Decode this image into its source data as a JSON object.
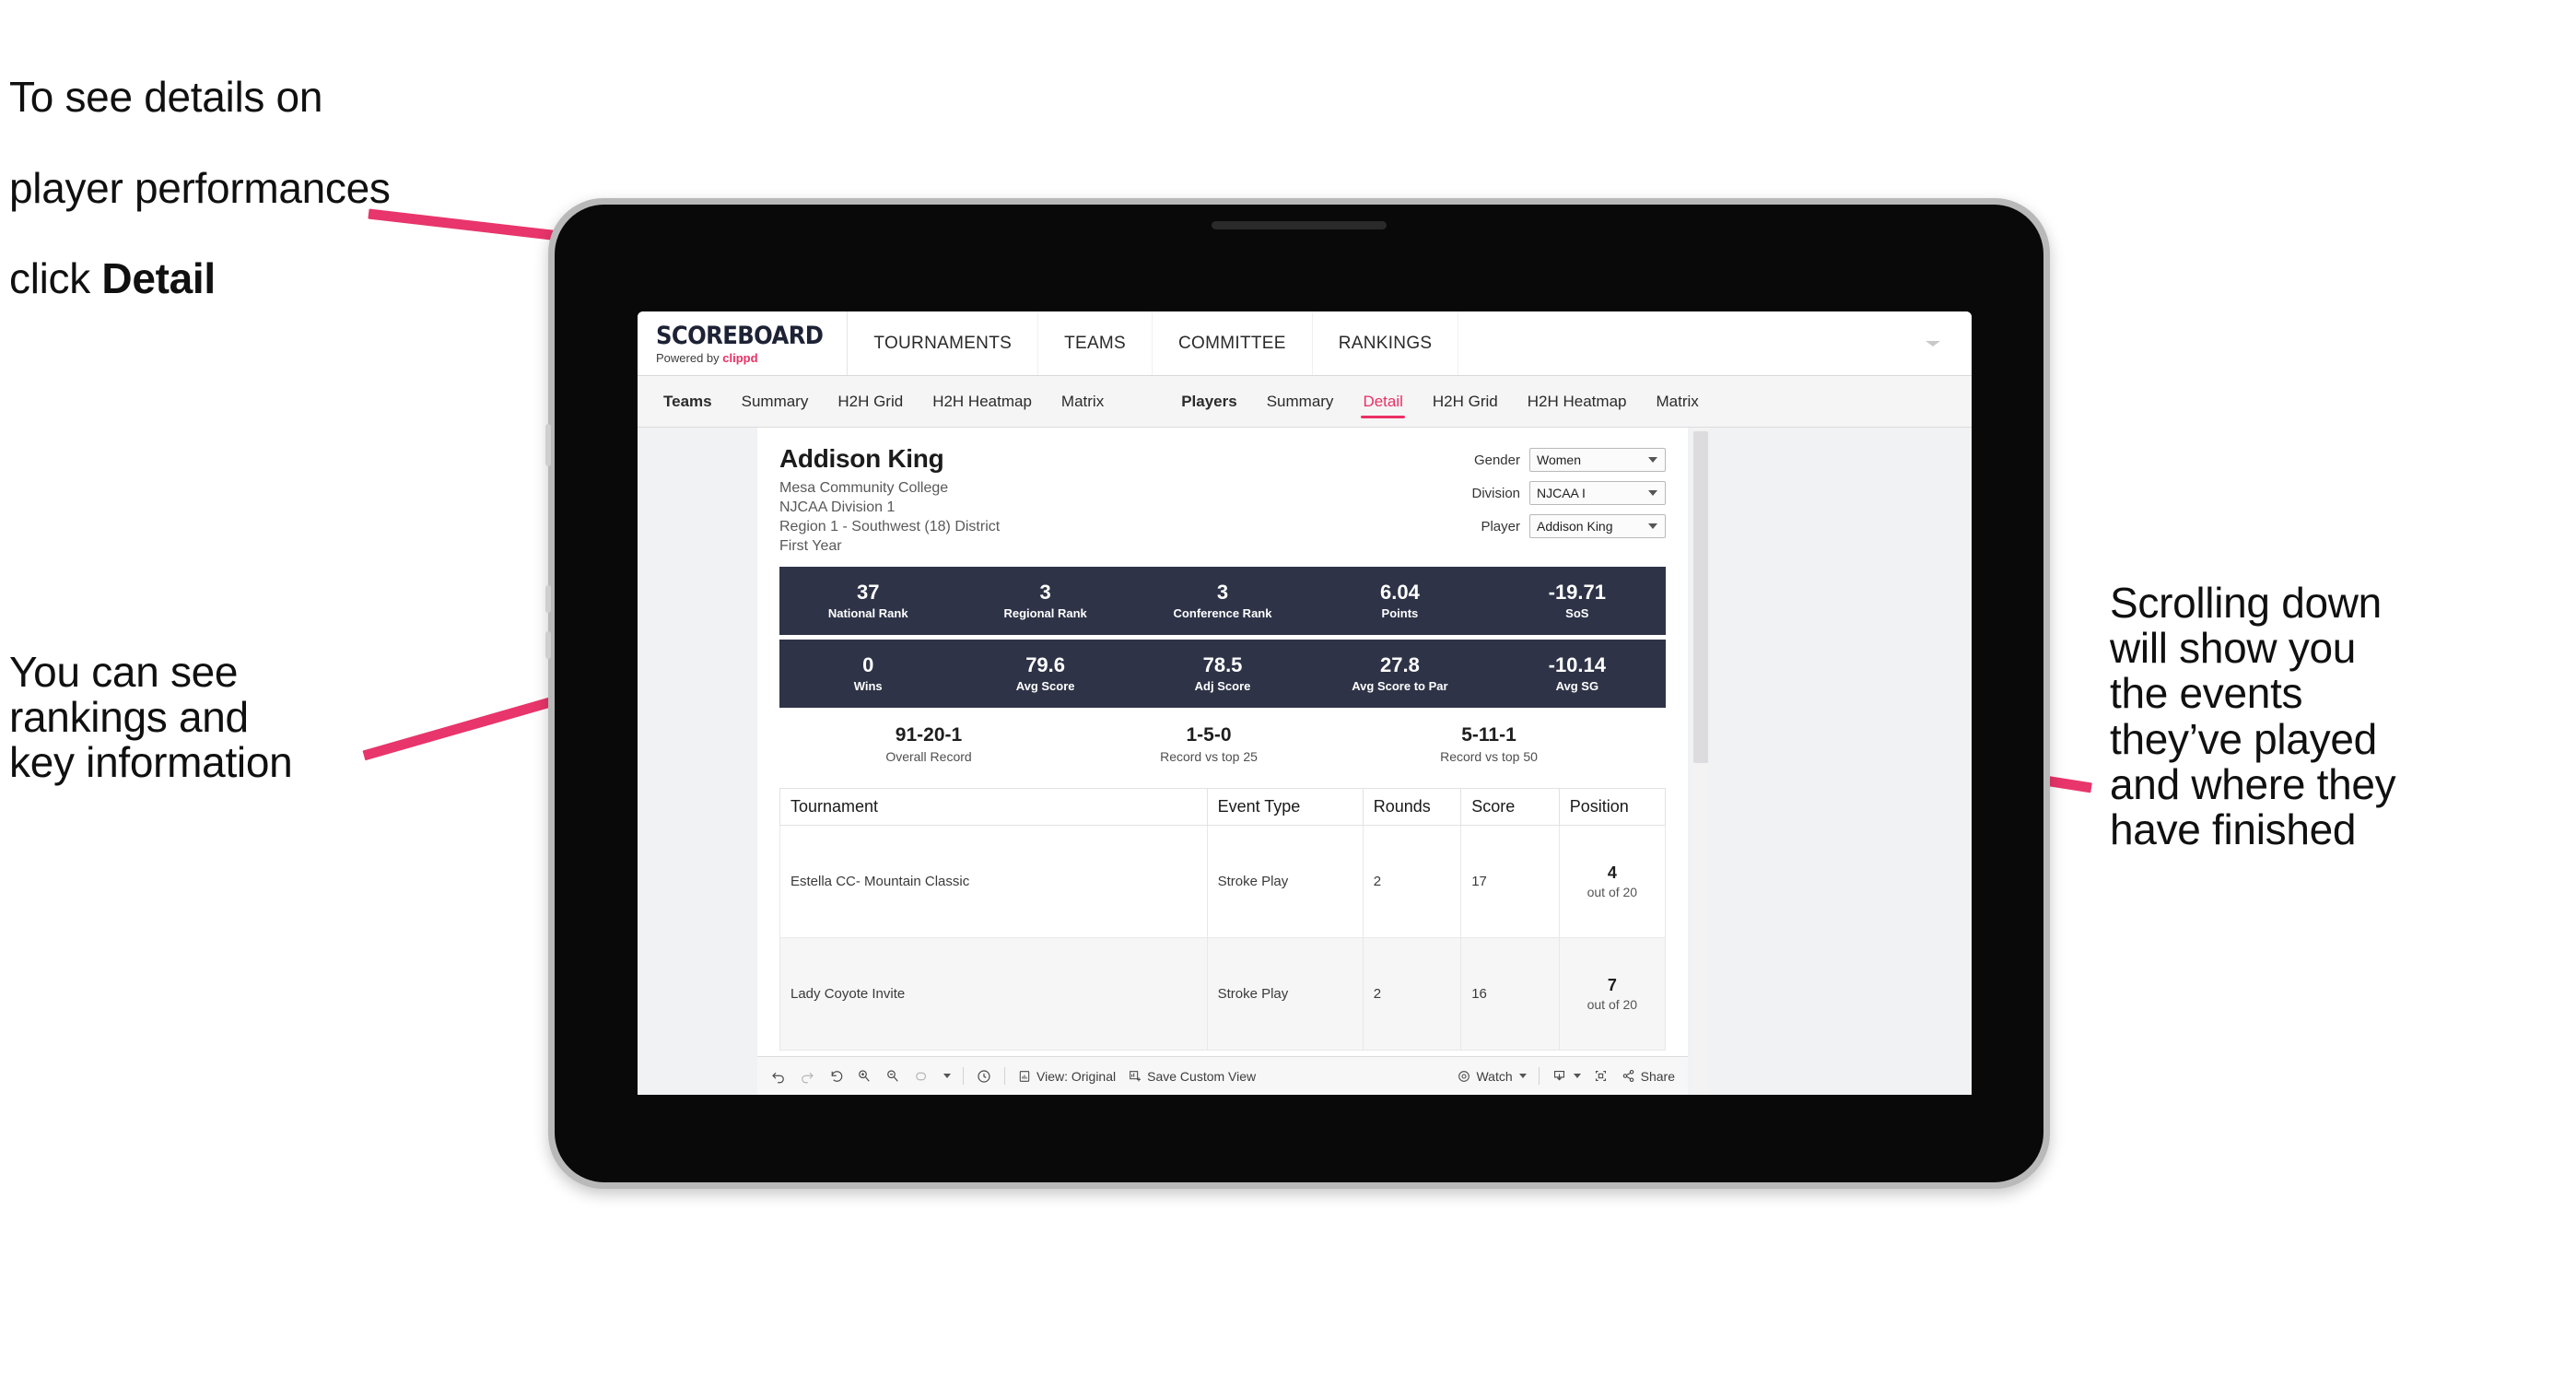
{
  "annotations": {
    "top_left_plain_1": "To see details on",
    "top_left_plain_2": "player performances",
    "top_left_plain_3": "click ",
    "top_left_bold": "Detail",
    "left": "You can see\nrankings and\nkey information",
    "right": "Scrolling down\nwill show you\nthe events\nthey’ve played\nand where they\nhave finished"
  },
  "colors": {
    "accent_pink": "#ec2f63",
    "stat_navy": "#2e3347",
    "arrow_pink": "#e8356b",
    "bezel_gray": "#b9b9b9",
    "screen_black": "#090909"
  },
  "app": {
    "brand": {
      "title": "SCOREBOARD",
      "powered_prefix": "Powered by ",
      "powered_name": "clippd"
    },
    "top_nav": [
      "TOURNAMENTS",
      "TEAMS",
      "COMMITTEE",
      "RANKINGS"
    ],
    "tabs_group_1": [
      {
        "label": "Teams",
        "lead": true,
        "active": false
      },
      {
        "label": "Summary",
        "lead": false,
        "active": false
      },
      {
        "label": "H2H Grid",
        "lead": false,
        "active": false
      },
      {
        "label": "H2H Heatmap",
        "lead": false,
        "active": false
      },
      {
        "label": "Matrix",
        "lead": false,
        "active": false
      }
    ],
    "tabs_group_2": [
      {
        "label": "Players",
        "lead": true,
        "active": false
      },
      {
        "label": "Summary",
        "lead": false,
        "active": false
      },
      {
        "label": "Detail",
        "lead": false,
        "active": true
      },
      {
        "label": "H2H Grid",
        "lead": false,
        "active": false
      },
      {
        "label": "H2H Heatmap",
        "lead": false,
        "active": false
      },
      {
        "label": "Matrix",
        "lead": false,
        "active": false
      }
    ]
  },
  "player": {
    "name": "Addison King",
    "school": "Mesa Community College",
    "division": "NJCAA Division 1",
    "region": "Region 1 - Southwest (18) District",
    "year": "First Year"
  },
  "filters": [
    {
      "label": "Gender",
      "value": "Women"
    },
    {
      "label": "Division",
      "value": "NJCAA I"
    },
    {
      "label": "Player",
      "value": "Addison King"
    }
  ],
  "stats_row_1": [
    {
      "value": "37",
      "label": "National Rank"
    },
    {
      "value": "3",
      "label": "Regional Rank"
    },
    {
      "value": "3",
      "label": "Conference Rank"
    },
    {
      "value": "6.04",
      "label": "Points"
    },
    {
      "value": "-19.71",
      "label": "SoS"
    }
  ],
  "stats_row_2": [
    {
      "value": "0",
      "label": "Wins"
    },
    {
      "value": "79.6",
      "label": "Avg Score"
    },
    {
      "value": "78.5",
      "label": "Adj Score"
    },
    {
      "value": "27.8",
      "label": "Avg Score to Par"
    },
    {
      "value": "-10.14",
      "label": "Avg SG"
    }
  ],
  "records": [
    {
      "value": "91-20-1",
      "label": "Overall Record"
    },
    {
      "value": "1-5-0",
      "label": "Record vs top 25"
    },
    {
      "value": "5-11-1",
      "label": "Record vs top 50"
    }
  ],
  "table": {
    "headers": [
      "Tournament",
      "Event Type",
      "Rounds",
      "Score",
      "Position"
    ],
    "rows": [
      {
        "tournament": "Estella CC- Mountain Classic",
        "event_type": "Stroke Play",
        "rounds": "2",
        "score": "17",
        "position_num": "4",
        "position_of": "out of 20"
      },
      {
        "tournament": "Lady Coyote Invite",
        "event_type": "Stroke Play",
        "rounds": "2",
        "score": "16",
        "position_num": "7",
        "position_of": "out of 20"
      }
    ]
  },
  "toolbar": {
    "view_label": "View: Original",
    "save_label": "Save Custom View",
    "watch_label": "Watch",
    "share_label": "Share",
    "icons": [
      "undo-icon",
      "redo-icon",
      "revert-icon",
      "zoom-in-icon",
      "zoom-out-icon",
      "pan-icon",
      "history-icon",
      "view-original-icon",
      "save-view-icon",
      "watch-icon",
      "download-icon",
      "device-icon",
      "share-icon"
    ]
  }
}
